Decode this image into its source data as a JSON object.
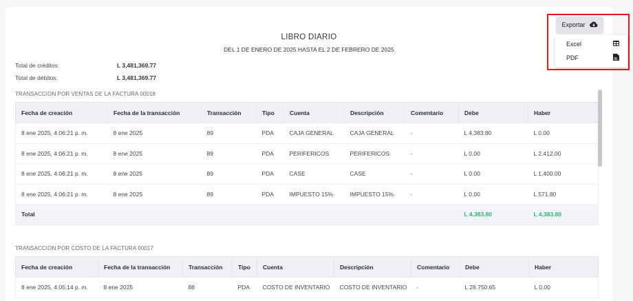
{
  "report": {
    "title": "LIBRO DIARIO",
    "subtitle": "DEL 1 DE ENERO DE 2025 HASTA EL 2 DE FEBRERO DE 2025"
  },
  "totals": {
    "credits_label": "Total de créditos:",
    "credits_value": "L 3,481,369.77",
    "debits_label": "Total de débitos:",
    "debits_value": "L 3,481,369.77"
  },
  "export": {
    "label": "Exportar",
    "options": [
      {
        "label": "Excel",
        "icon": "table-icon"
      },
      {
        "label": "PDF",
        "icon": "pdf-file-icon"
      }
    ]
  },
  "columns": [
    "Fecha de creación",
    "Fecha de la transacción",
    "Transacción",
    "Tipo",
    "Cuenta",
    "Descripción",
    "Comentario",
    "Debe",
    "Haber"
  ],
  "sections": [
    {
      "title": "TRANSACCION POR VENTAS DE LA FACTURA 00018",
      "rows": [
        [
          "8 ene 2025, 4:06:21 p. m.",
          "8 ene 2025",
          "89",
          "PDA",
          "CAJA GENERAL",
          "CAJA GENERAL",
          "-",
          "L 4,383.80",
          "L 0.00"
        ],
        [
          "8 ene 2025, 4:06:21 p. m.",
          "8 ene 2025",
          "89",
          "PDA",
          "PERIFERICOS",
          "PERIFERICOS",
          "-",
          "L 0.00",
          "L 2,412.00"
        ],
        [
          "8 ene 2025, 4:06:21 p. m.",
          "8 ene 2025",
          "89",
          "PDA",
          "CASE",
          "CASE",
          "-",
          "L 0.00",
          "L 1,400.00"
        ],
        [
          "8 ene 2025, 4:06:21 p. m.",
          "8 ene 2025",
          "89",
          "PDA",
          "IMPUESTO 15%",
          "IMPUESTO 15%",
          "-",
          "L 0.00",
          "L 571.80"
        ]
      ],
      "total": {
        "label": "Total",
        "debe": "L 4,383.80",
        "haber": "L 4,383.80"
      }
    },
    {
      "title": "TRANSACCION POR COSTO DE LA FACTURA 00017",
      "rows": [
        [
          "8 ene 2025, 4:05:14 p. m.",
          "8 ene 2025",
          "88",
          "PDA",
          "COSTO DE INVENTARIO",
          "COSTO DE INVENTARIO",
          "-",
          "L 28,750.65",
          "L 0.00"
        ]
      ]
    }
  ]
}
